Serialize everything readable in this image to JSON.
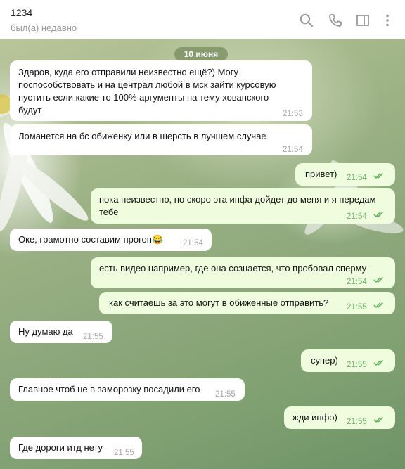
{
  "header": {
    "title": "1234",
    "status": "был(а) недавно",
    "icons": [
      "search-icon",
      "phone-icon",
      "sidebar-toggle-icon",
      "more-vert-icon"
    ]
  },
  "chat": {
    "date": "10 июня",
    "messages": [
      {
        "dir": "in",
        "text": "Здаров, куда его отправили неизвестно ещё?) Могу поспособствовать и на централ любой в мск зайти курсовую пустить если какие то 100% аргументы на тему хованского будут",
        "time": "21:53"
      },
      {
        "dir": "in",
        "text": "Ломанется на бс обиженку или в шерсть в лучшем случае",
        "time": "21:54"
      },
      {
        "dir": "out",
        "text": "привет)",
        "time": "21:54"
      },
      {
        "dir": "out",
        "text": "пока неизвестно, но скоро эта инфа дойдет до меня и я передам тебе",
        "time": "21:54"
      },
      {
        "dir": "in",
        "text": "Оке, грамотно составим прогон😂",
        "time": "21:54"
      },
      {
        "dir": "out",
        "text": "есть видео например, где она сознается, что пробовал сперму",
        "time": "21:54"
      },
      {
        "dir": "out",
        "text": "как считаешь за это могут в обиженные отправить?",
        "time": "21:55"
      },
      {
        "dir": "in",
        "text": "Ну думаю да",
        "time": "21:55"
      },
      {
        "dir": "out",
        "text": "супер)",
        "time": "21:55"
      },
      {
        "dir": "in",
        "text": "Главное чтоб не в заморозку посадили его",
        "time": "21:55"
      },
      {
        "dir": "out",
        "text": "жди инфо)",
        "time": "21:55"
      },
      {
        "dir": "in",
        "text": "Где дороги итд нету",
        "time": "21:55"
      }
    ]
  },
  "colors": {
    "incoming_bubble": "#ffffff",
    "outgoing_bubble": "#effdde",
    "read_ticks": "#5fb35d"
  }
}
